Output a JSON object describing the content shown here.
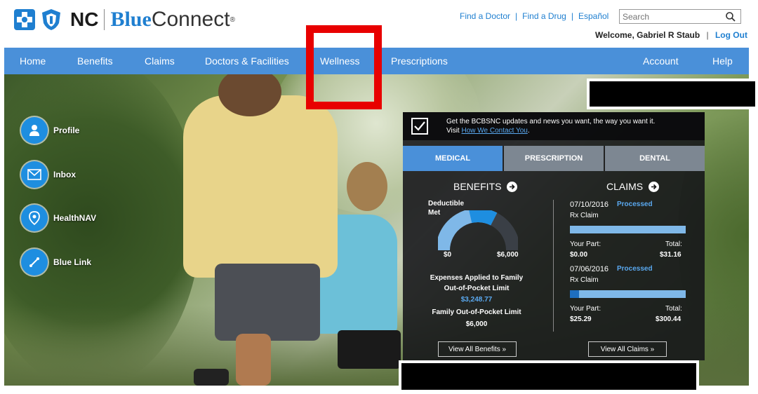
{
  "header": {
    "logo": {
      "nc": "NC",
      "blue": "Blue",
      "connect": "Connect",
      "tm": "®"
    },
    "links": [
      "Find a Doctor",
      "Find a Drug",
      "Español"
    ],
    "search": {
      "placeholder": "Search",
      "value": ""
    },
    "welcome": "Welcome, Gabriel R Staub",
    "logout": "Log Out"
  },
  "nav": {
    "items": [
      {
        "label": "Home"
      },
      {
        "label": "Benefits"
      },
      {
        "label": "Claims"
      },
      {
        "label": "Doctors & Facilities"
      },
      {
        "label": "Wellness"
      },
      {
        "label": "Prescriptions"
      },
      {
        "label": "Account"
      },
      {
        "label": "Help"
      }
    ]
  },
  "sidebar": {
    "items": [
      {
        "label": "Profile",
        "icon": "person-icon"
      },
      {
        "label": "Inbox",
        "icon": "envelope-icon"
      },
      {
        "label": "HealthNAV",
        "icon": "location-pin-icon"
      },
      {
        "label": "Blue Link",
        "icon": "link-icon"
      }
    ]
  },
  "panel": {
    "banner": {
      "line1": "Get the BCBSNC updates and news you want, the way you want it.",
      "visit": "Visit ",
      "link": "How We Contact You",
      "end": "."
    },
    "tabs": [
      {
        "label": "MEDICAL",
        "active": true
      },
      {
        "label": "PRESCRIPTION",
        "active": false
      },
      {
        "label": "DENTAL",
        "active": false
      }
    ],
    "benefits": {
      "title": "BENEFITS",
      "gauge_label": "Deductible Met",
      "gauge_min": "$0",
      "gauge_max": "$6,000",
      "gauge_progress": 0.65,
      "expenses_label": "Expenses Applied to Family Out-of-Pocket Limit",
      "expenses_value": "$3,248.77",
      "limit_label": "Family Out-of-Pocket Limit",
      "limit_value": "$6,000",
      "view_all": "View All Benefits  »"
    },
    "claims": {
      "title": "CLAIMS",
      "items": [
        {
          "date": "07/10/2016",
          "status": "Processed",
          "type": "Rx Claim",
          "your_part_label": "Your Part:",
          "your_part": "$0.00",
          "total_label": "Total:",
          "total": "$31.16",
          "progress": 0.0
        },
        {
          "date": "07/06/2016",
          "status": "Processed",
          "type": "Rx Claim",
          "your_part_label": "Your Part:",
          "your_part": "$25.29",
          "total_label": "Total:",
          "total": "$300.44",
          "progress": 0.08
        }
      ],
      "view_all": "View All Claims  »"
    }
  },
  "colors": {
    "brand_blue": "#1f7fd0",
    "nav_blue": "#4a90d9",
    "highlight": "#e80000"
  }
}
